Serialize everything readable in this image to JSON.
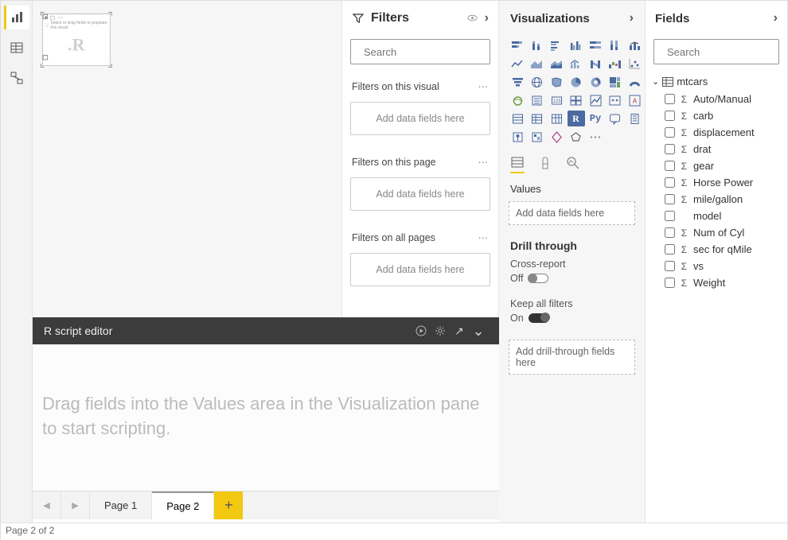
{
  "leftRail": {
    "report": "Report view",
    "data": "Data view",
    "model": "Model view"
  },
  "canvas": {
    "visualTip": "Select or drag fields to populate this visual",
    "rGlyph": ".R"
  },
  "rEditor": {
    "title": "R script editor",
    "placeholder": "Drag fields into the Values area in the Visualization pane to start scripting."
  },
  "pageTabs": {
    "page1": "Page 1",
    "page2": "Page 2"
  },
  "status": "Page 2 of 2",
  "filters": {
    "title": "Filters",
    "searchPlaceholder": "Search",
    "onVisual": "Filters on this visual",
    "onPage": "Filters on this page",
    "onAll": "Filters on all pages",
    "addFields": "Add data fields here"
  },
  "viz": {
    "title": "Visualizations",
    "values": "Values",
    "valuesDrop": "Add data fields here",
    "drill": "Drill through",
    "crossReport": "Cross-report",
    "crossReportState": "Off",
    "keepAll": "Keep all filters",
    "keepAllState": "On",
    "drillDrop": "Add drill-through fields here",
    "rLabel": "R",
    "pyLabel": "Py"
  },
  "fields": {
    "title": "Fields",
    "searchPlaceholder": "Search",
    "table": "mtcars",
    "items": [
      {
        "name": "Auto/Manual",
        "numeric": true
      },
      {
        "name": "carb",
        "numeric": true
      },
      {
        "name": "displacement",
        "numeric": true
      },
      {
        "name": "drat",
        "numeric": true
      },
      {
        "name": "gear",
        "numeric": true
      },
      {
        "name": "Horse Power",
        "numeric": true
      },
      {
        "name": "mile/gallon",
        "numeric": true
      },
      {
        "name": "model",
        "numeric": false
      },
      {
        "name": "Num of Cyl",
        "numeric": true
      },
      {
        "name": "sec for qMile",
        "numeric": true
      },
      {
        "name": "vs",
        "numeric": true
      },
      {
        "name": "Weight",
        "numeric": true
      }
    ]
  }
}
